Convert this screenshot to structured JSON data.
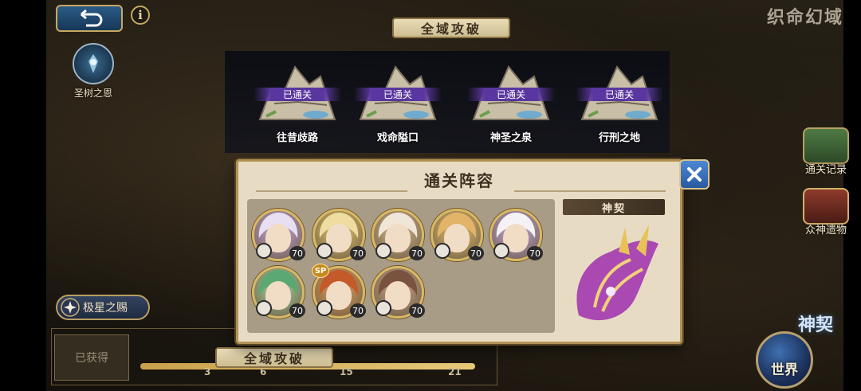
{
  "header": {
    "title": "全域攻破",
    "game_logo": "织命幻域",
    "back_icon": "back-arrow-icon",
    "info_label": "i"
  },
  "left_side": {
    "tree_label": "圣树之恩",
    "star_gift_label": "极星之赐"
  },
  "right_side": {
    "record_label": "通关记录",
    "relics_label": "众神遗物",
    "shenqi_label": "神契",
    "world_label": "世界"
  },
  "stages": [
    {
      "name": "往昔歧路",
      "status": "已通关"
    },
    {
      "name": "戏命隘口",
      "status": "已通关"
    },
    {
      "name": "神圣之泉",
      "status": "已通关"
    },
    {
      "name": "行刑之地",
      "status": "已通关"
    }
  ],
  "modal": {
    "title": "通关阵容",
    "close_icon": "close-x-icon",
    "relic_header": "神契",
    "characters": [
      {
        "level": "70",
        "hair": "#e9dff2",
        "frame": "#c9a7e0",
        "sp": false
      },
      {
        "level": "70",
        "hair": "#efdca0",
        "frame": "#e6c86a",
        "sp": false
      },
      {
        "level": "70",
        "hair": "#f0e6d8",
        "frame": "#d9b88a",
        "sp": false
      },
      {
        "level": "70",
        "hair": "#e2b46a",
        "frame": "#e8c16a",
        "sp": false
      },
      {
        "level": "70",
        "hair": "#f4f2f4",
        "frame": "#c7a8e6",
        "sp": false
      },
      {
        "level": "70",
        "hair": "#5ca872",
        "frame": "#a9d6a2",
        "sp": false
      },
      {
        "level": "70",
        "hair": "#c45a2a",
        "frame": "#e6a25a",
        "sp": true,
        "sp_label": "SP"
      },
      {
        "level": "70",
        "hair": "#7a5240",
        "frame": "#c9a484",
        "sp": false
      }
    ]
  },
  "bottom": {
    "acquired_label": "已获得",
    "plate_label": "全域攻破",
    "milestones": [
      "3",
      "6",
      "15",
      "21"
    ]
  },
  "colors": {
    "accent_gold": "#b29254",
    "cleared_purple": "#5a37a0",
    "close_blue": "#2a5aa0"
  }
}
